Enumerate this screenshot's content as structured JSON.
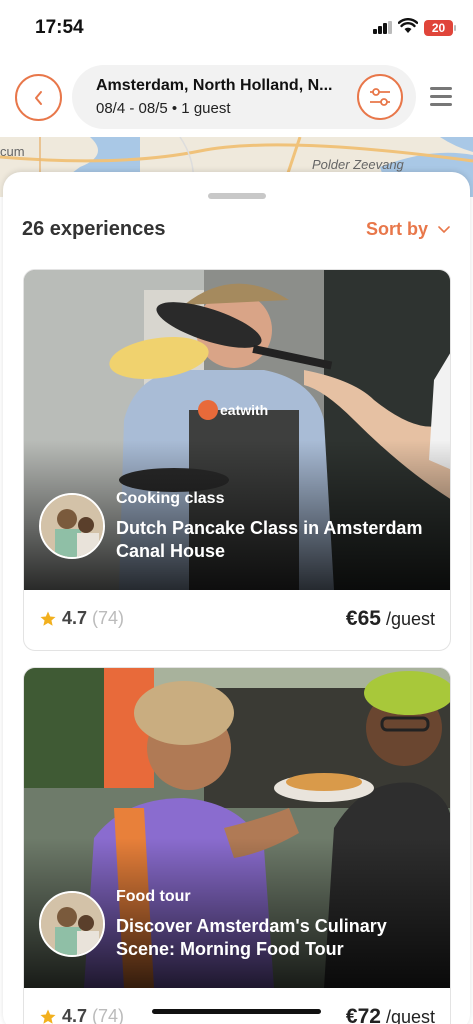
{
  "status_bar": {
    "time": "17:54",
    "battery": "20"
  },
  "header": {
    "location": "Amsterdam, North Holland, N...",
    "dates_guests": "08/4 - 08/5 • 1 guest"
  },
  "map": {
    "label_left": "cum",
    "label_right": "Polder Zeevang"
  },
  "results": {
    "count_label": "26 experiences",
    "sort_label": "Sort by"
  },
  "experiences": [
    {
      "category": "Cooking class",
      "title": "Dutch Pancake Class in Amsterdam Canal House",
      "rating": "4.7",
      "reviews": "(74)",
      "price": "€65",
      "price_unit": "/guest"
    },
    {
      "category": "Food tour",
      "title": "Discover Amsterdam's Culinary Scene: Morning Food Tour",
      "rating": "4.7",
      "reviews": "(74)",
      "price": "€72",
      "price_unit": "/guest"
    }
  ],
  "colors": {
    "accent": "#e8774a",
    "star": "#f2b01e"
  }
}
